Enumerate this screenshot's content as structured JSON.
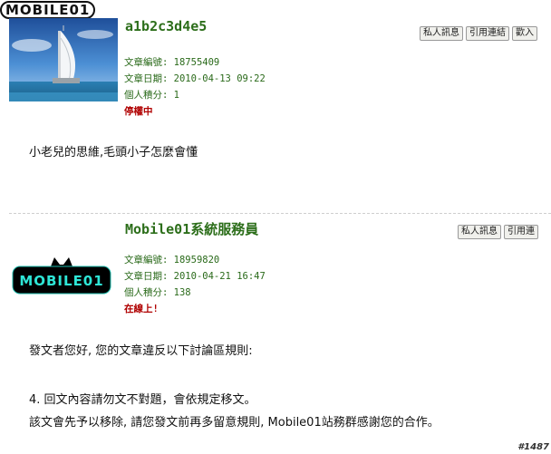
{
  "site_logo": {
    "text": "MOBILE01"
  },
  "posts": [
    {
      "author": "a1b2c3d4e5",
      "buttons": [
        "私人訊息",
        "引用連結",
        "歡入"
      ],
      "meta": [
        {
          "label": "文章編號",
          "value": "18755409"
        },
        {
          "label": "文章日期",
          "value": "2010-04-13 09:22"
        },
        {
          "label": "個人積分",
          "value": "1"
        }
      ],
      "status": "停權中",
      "body": [
        "小老兒的思維,毛頭小子怎麼會懂"
      ]
    },
    {
      "author": "Mobile01系統服務員",
      "buttons": [
        "私人訊息",
        "引用連"
      ],
      "meta": [
        {
          "label": "文章編號",
          "value": "18959820"
        },
        {
          "label": "文章日期",
          "value": "2010-04-21 16:47"
        },
        {
          "label": "個人積分",
          "value": "138"
        }
      ],
      "status": "在線上!",
      "avatar_logo": "MOBILE01",
      "body": [
        "發文者您好, 您的文章違反以下討論區規則:",
        "4. 回文內容請勿文不對題，會依規定移文。",
        "該文會先予以移除, 請您發文前再多留意規則, Mobile01站務群感謝您的合作。"
      ]
    }
  ],
  "post_number": "#1487"
}
